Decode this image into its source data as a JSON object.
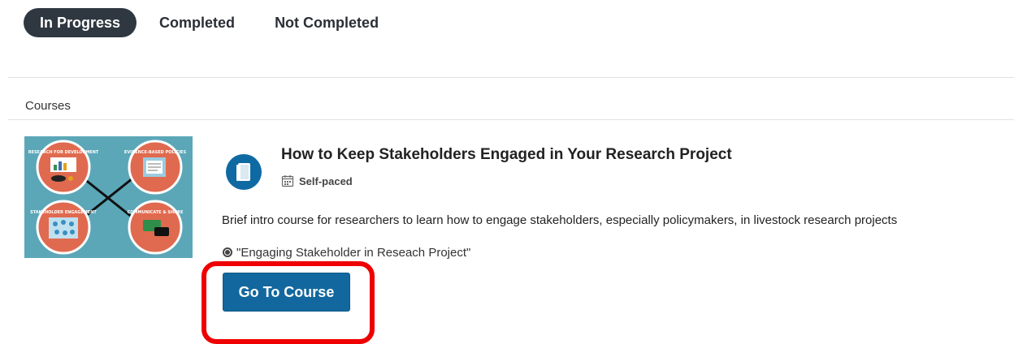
{
  "tabs": [
    {
      "label": "In Progress",
      "active": true
    },
    {
      "label": "Completed",
      "active": false
    },
    {
      "label": "Not Completed",
      "active": false
    }
  ],
  "section": {
    "label": "Courses"
  },
  "course": {
    "title": "How to Keep Stakeholders Engaged in Your Research Project",
    "pace": "Self-paced",
    "description": "Brief intro course for researchers to learn how to engage stakeholders, especially policymakers, in livestock research projects",
    "badge": "\"Engaging Stakeholder in Reseach Project\"",
    "button_label": "Go To Course",
    "icon": "book-icon"
  },
  "thumbnail": {
    "labels": [
      "RESEARCH FOR DEVELOPMENT",
      "EVIDENCE-BASED POLICIES",
      "STAKEHOLDER ENGAGEMENT",
      "COMMUNICATE & SHARE"
    ]
  },
  "colors": {
    "active_tab": "#2f3740",
    "primary_button": "#12689e",
    "course_icon": "#0f6aa3",
    "thumbnail_bg": "#5ba7b8",
    "thumbnail_circle": "#e06a4f",
    "highlight": "#ee0000"
  }
}
